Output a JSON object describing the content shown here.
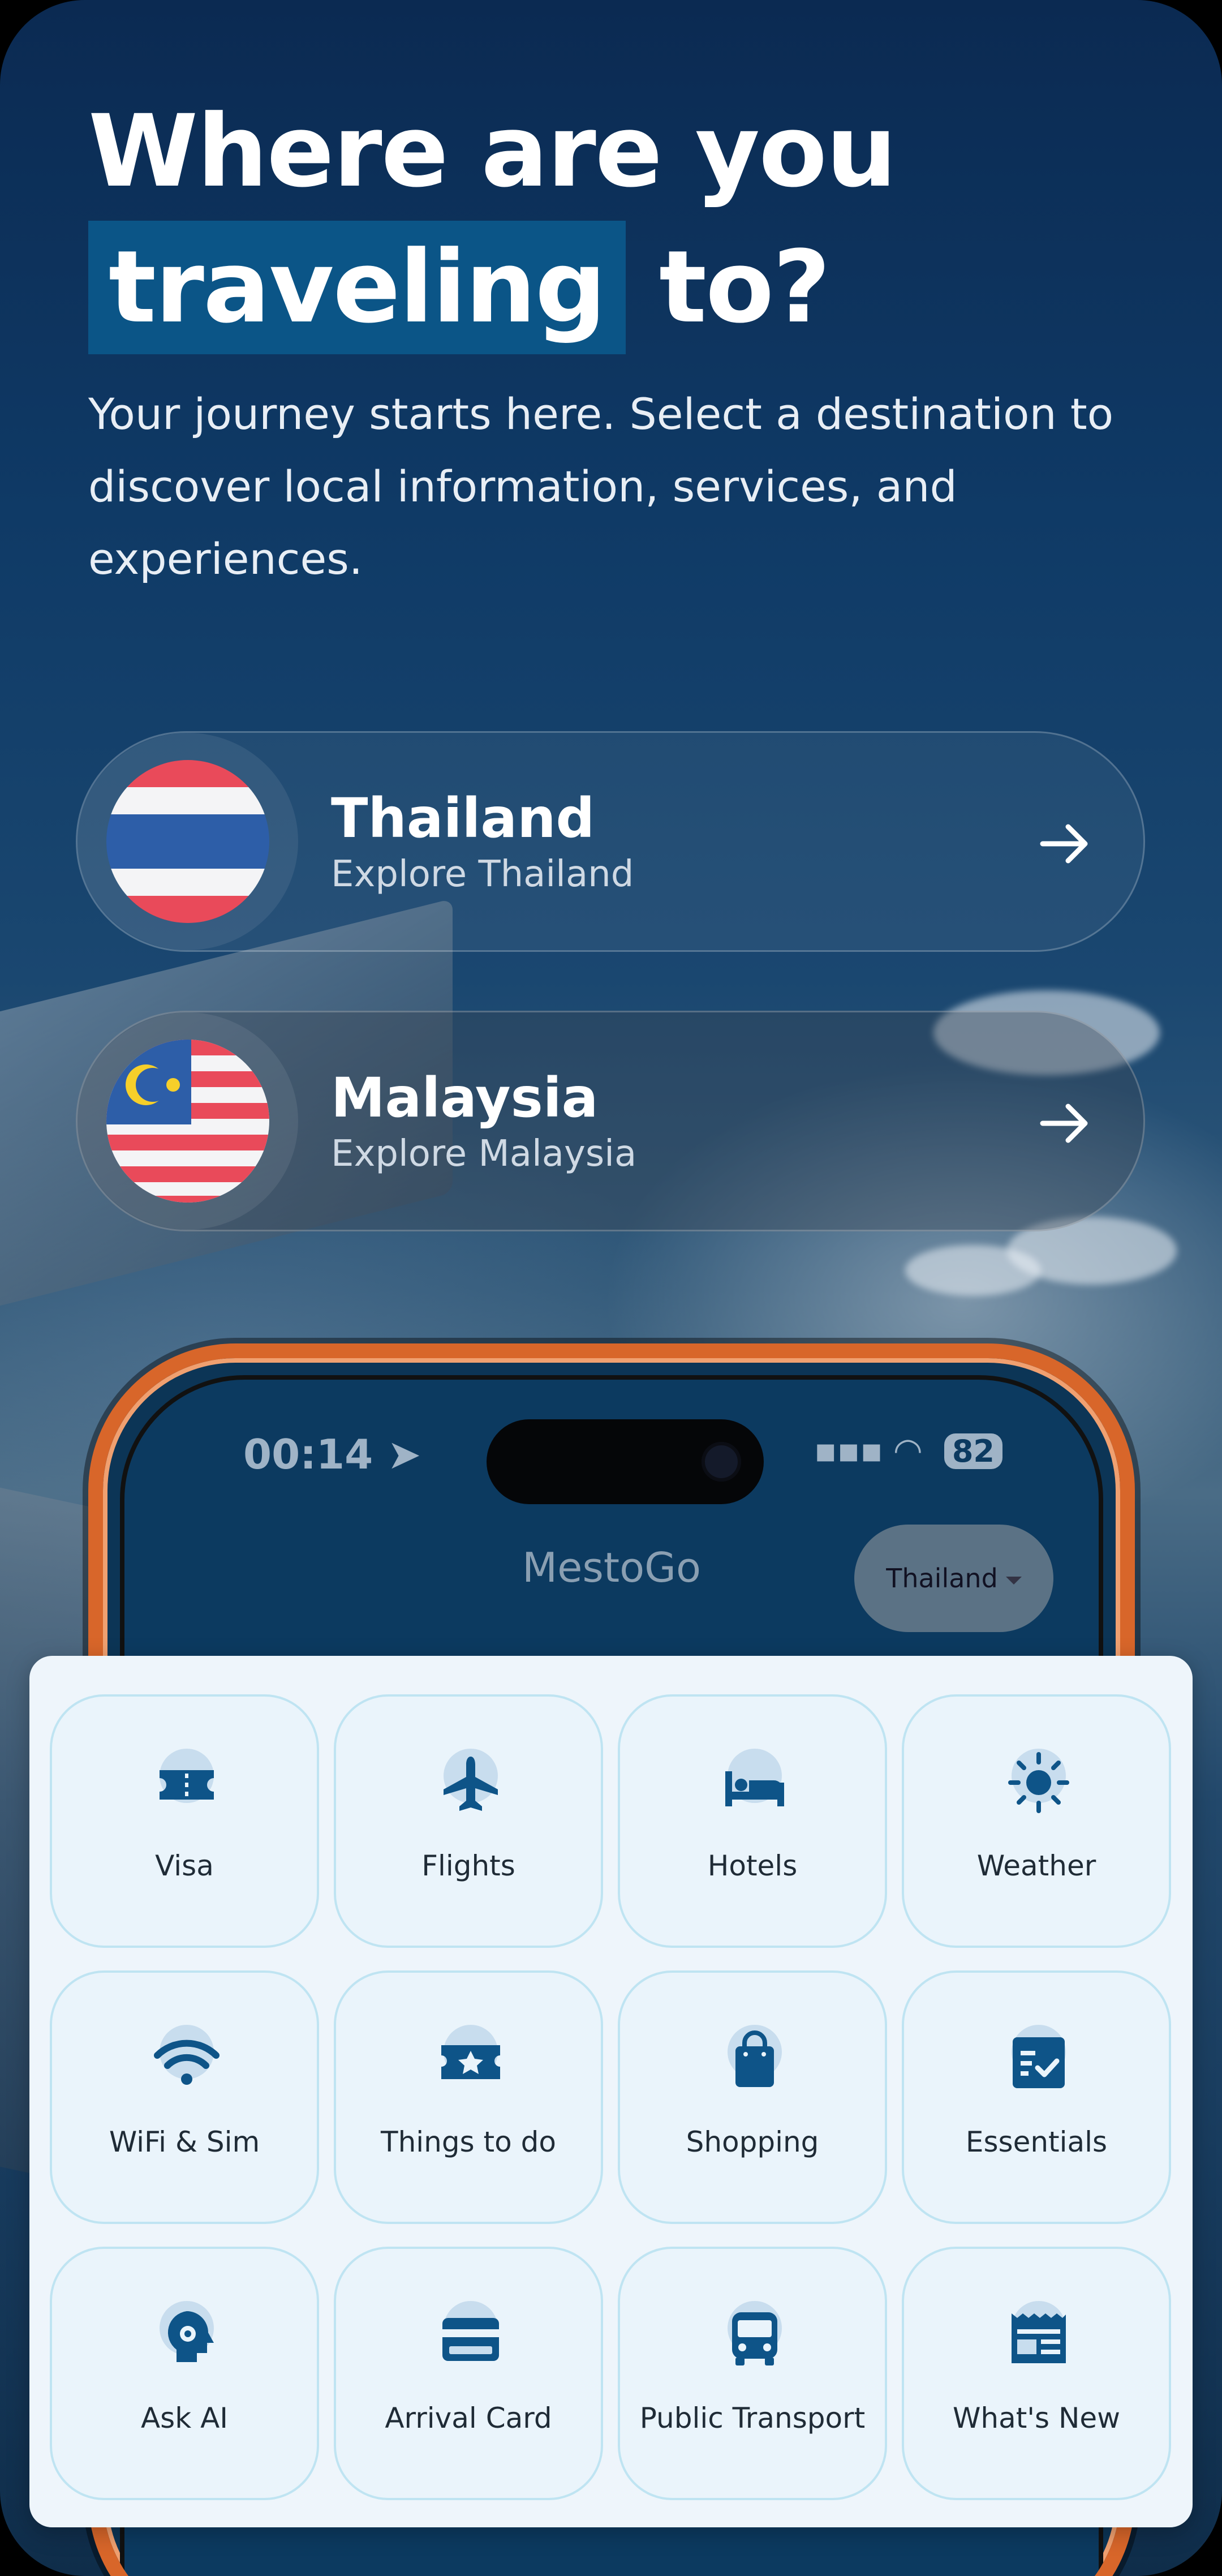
{
  "hero": {
    "title_line1": "Where are you",
    "title_highlight": "traveling",
    "title_rest": "to?",
    "subtitle": "Your journey starts here. Select a destination to discover local information, services, and experiences."
  },
  "destinations": [
    {
      "name": "Thailand",
      "subtitle": "Explore Thailand",
      "flag_icon": "thailand-flag-icon"
    },
    {
      "name": "Malaysia",
      "subtitle": "Explore Malaysia",
      "flag_icon": "malaysia-flag-icon"
    }
  ],
  "phone_preview": {
    "time": "00:14",
    "battery": "82",
    "app_title": "MestoGo",
    "country_selector": "Thailand"
  },
  "services": [
    {
      "label": "Visa",
      "icon": "ticket-icon"
    },
    {
      "label": "Flights",
      "icon": "airplane-icon"
    },
    {
      "label": "Hotels",
      "icon": "bed-icon"
    },
    {
      "label": "Weather",
      "icon": "sun-icon"
    },
    {
      "label": "WiFi & Sim",
      "icon": "wifi-icon"
    },
    {
      "label": "Things to do",
      "icon": "star-ticket-icon"
    },
    {
      "label": "Shopping",
      "icon": "shopping-bag-icon"
    },
    {
      "label": "Essentials",
      "icon": "checklist-icon"
    },
    {
      "label": "Ask AI",
      "icon": "ai-head-icon"
    },
    {
      "label": "Arrival Card",
      "icon": "card-icon"
    },
    {
      "label": "Public Transport",
      "icon": "bus-icon"
    },
    {
      "label": "What's New",
      "icon": "news-icon"
    }
  ],
  "colors": {
    "accent": "#0b5587",
    "icon": "#0e5488",
    "tile_border": "#bfe4f2",
    "phone_frame": "#d8662a"
  }
}
